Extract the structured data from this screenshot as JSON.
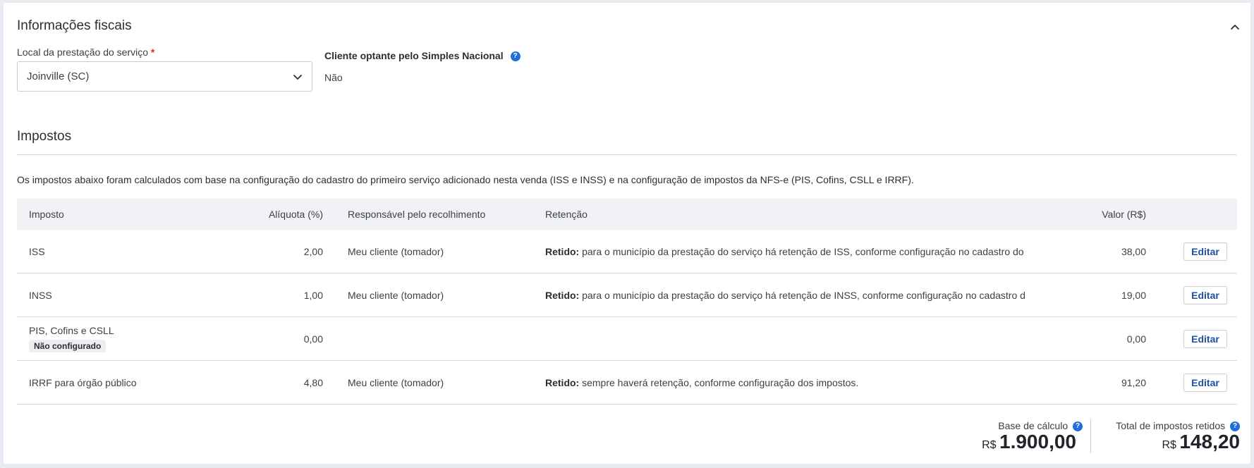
{
  "fiscal": {
    "title": "Informações fiscais",
    "local_label": "Local da prestação do serviço",
    "required_mark": "*",
    "local_value": "Joinville (SC)",
    "simples_label": "Cliente optante pelo Simples Nacional",
    "simples_value": "Não"
  },
  "impostos": {
    "title": "Impostos",
    "description": "Os impostos abaixo foram calculados com base na configuração do cadastro do primeiro serviço adicionado nesta venda (ISS e INSS) e na configuração de impostos da NFS-e (PIS, Cofins, CSLL e IRRF).",
    "headers": {
      "imposto": "Imposto",
      "aliquota": "Alíquota (%)",
      "responsavel": "Responsável pelo recolhimento",
      "retencao": "Retenção",
      "valor": "Valor (R$)"
    },
    "rows": [
      {
        "imposto": "ISS",
        "badge": "",
        "aliquota": "2,00",
        "responsavel": "Meu cliente (tomador)",
        "retencao_bold": "Retido:",
        "retencao_text": " para o município da prestação do serviço há retenção de ISS, conforme configuração no cadastro do serviço.",
        "valor": "38,00",
        "edit_label": "Editar"
      },
      {
        "imposto": "INSS",
        "badge": "",
        "aliquota": "1,00",
        "responsavel": "Meu cliente (tomador)",
        "retencao_bold": "Retido:",
        "retencao_text": " para o município da prestação do serviço há retenção de INSS, conforme configuração no cadastro do serviço.",
        "valor": "19,00",
        "edit_label": "Editar"
      },
      {
        "imposto": "PIS, Cofins e CSLL",
        "badge": "Não configurado",
        "aliquota": "0,00",
        "responsavel": "",
        "retencao_bold": "",
        "retencao_text": "",
        "valor": "0,00",
        "edit_label": "Editar"
      },
      {
        "imposto": "IRRF para órgão público",
        "badge": "",
        "aliquota": "4,80",
        "responsavel": "Meu cliente (tomador)",
        "retencao_bold": "Retido:",
        "retencao_text": " sempre haverá retenção, conforme configuração dos impostos.",
        "valor": "91,20",
        "edit_label": "Editar"
      }
    ]
  },
  "totals": {
    "base_label": "Base de cálculo",
    "base_currency": "R$",
    "base_value": "1.900,00",
    "retidos_label": "Total de impostos retidos",
    "retidos_currency": "R$",
    "retidos_value": "148,20"
  },
  "icons": {
    "collapse": "chevron-up-icon",
    "dropdown": "chevron-down-icon",
    "help": "question-circle-icon"
  },
  "colors": {
    "accent": "#1f6fd6",
    "required": "#d32f2f",
    "header_bg": "#f0f2f6"
  }
}
